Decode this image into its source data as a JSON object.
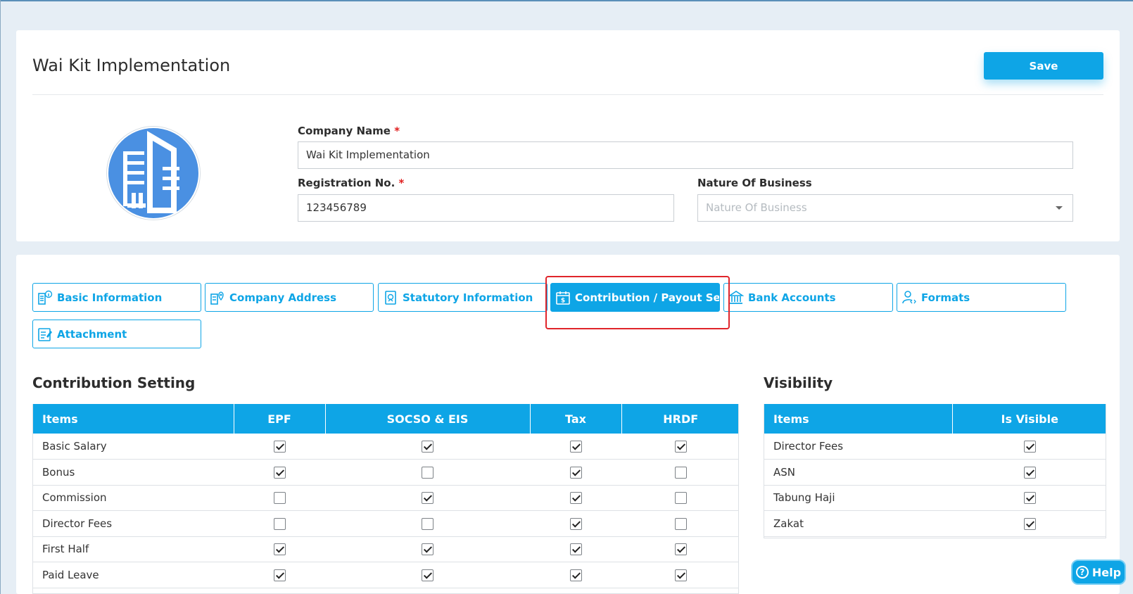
{
  "header": {
    "title": "Wai Kit Implementation",
    "save_label": "Save"
  },
  "form": {
    "company_name_label": "Company Name",
    "company_name_value": "Wai Kit Implementation",
    "registration_label": "Registration No.",
    "registration_value": "123456789",
    "nature_label": "Nature Of Business",
    "nature_placeholder": "Nature Of Business",
    "required_mark": "*"
  },
  "tabs": [
    {
      "label": "Basic Information",
      "icon": "building-info-icon",
      "active": false
    },
    {
      "label": "Company Address",
      "icon": "building-location-icon",
      "active": false
    },
    {
      "label": "Statutory Information",
      "icon": "document-badge-icon",
      "active": false
    },
    {
      "label": "Contribution / Payout Set...",
      "icon": "calendar-dollar-icon",
      "active": true
    },
    {
      "label": "Bank Accounts",
      "icon": "bank-icon",
      "active": false
    },
    {
      "label": "Formats",
      "icon": "user-code-icon",
      "active": false
    },
    {
      "label": "Attachment",
      "icon": "document-edit-icon",
      "active": false
    }
  ],
  "contribution": {
    "title": "Contribution Setting",
    "columns": [
      "Items",
      "EPF",
      "SOCSO & EIS",
      "Tax",
      "HRDF"
    ],
    "rows": [
      {
        "item": "Basic Salary",
        "epf": true,
        "socso": true,
        "tax": true,
        "hrdf": true
      },
      {
        "item": "Bonus",
        "epf": true,
        "socso": false,
        "tax": true,
        "hrdf": false
      },
      {
        "item": "Commission",
        "epf": false,
        "socso": true,
        "tax": true,
        "hrdf": false
      },
      {
        "item": "Director Fees",
        "epf": false,
        "socso": false,
        "tax": true,
        "hrdf": false
      },
      {
        "item": "First Half",
        "epf": true,
        "socso": true,
        "tax": true,
        "hrdf": true
      },
      {
        "item": "Paid Leave",
        "epf": true,
        "socso": true,
        "tax": true,
        "hrdf": true
      }
    ]
  },
  "visibility": {
    "title": "Visibility",
    "columns": [
      "Items",
      "Is Visible"
    ],
    "rows": [
      {
        "item": "Director Fees",
        "visible": true
      },
      {
        "item": "ASN",
        "visible": true
      },
      {
        "item": "Tabung Haji",
        "visible": true
      },
      {
        "item": "Zakat",
        "visible": true
      }
    ]
  },
  "help": {
    "label": "Help",
    "icon_glyph": "?"
  },
  "colors": {
    "accent": "#0ea5e6",
    "highlight": "#e0252b",
    "background": "#e6eef5"
  }
}
